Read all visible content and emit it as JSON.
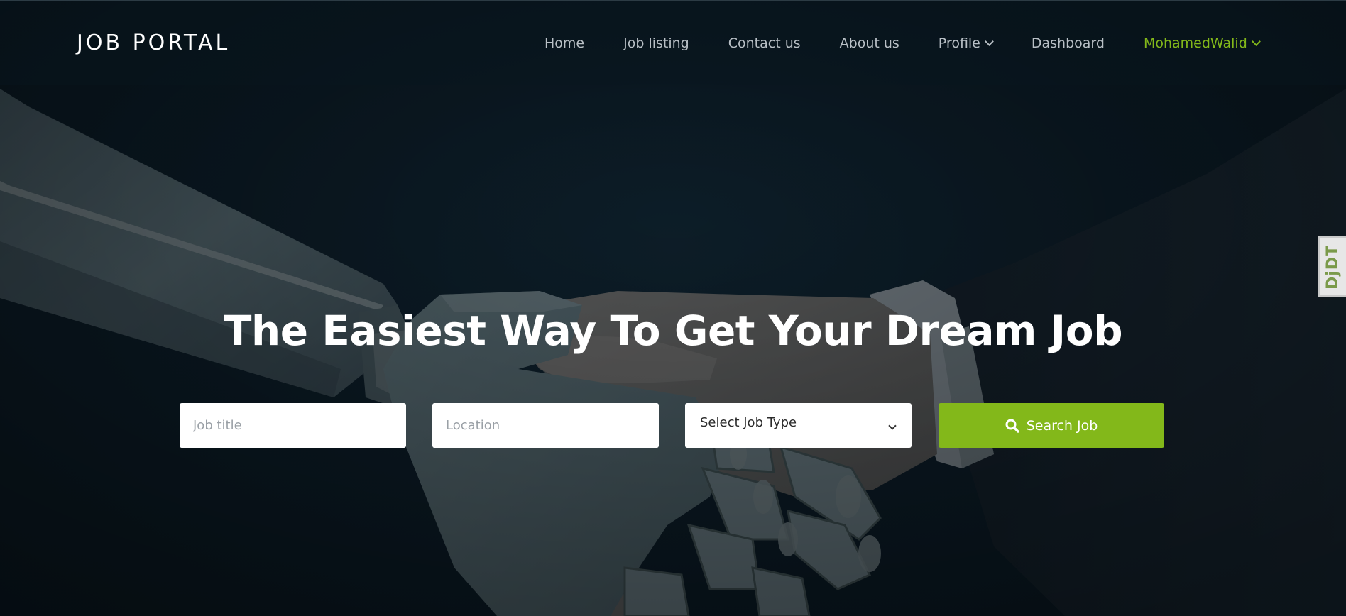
{
  "header": {
    "logo": "JOB PORTAL",
    "nav": [
      {
        "label": "Home"
      },
      {
        "label": "Job listing"
      },
      {
        "label": "Contact us"
      },
      {
        "label": "About us"
      },
      {
        "label": "Profile"
      },
      {
        "label": "Dashboard"
      }
    ],
    "user": "MohamedWalid"
  },
  "hero": {
    "title": "The Easiest Way To Get Your Dream Job",
    "image": "robot-human-handshake"
  },
  "search": {
    "job_title_placeholder": "Job title",
    "location_placeholder": "Location",
    "job_type_selected": "Select Job Type",
    "button_label": "Search Job"
  },
  "debug_toolbar": {
    "label": "DjDT"
  },
  "colors": {
    "accent": "#83b81a",
    "background": "#0a1a24",
    "nav_text": "#b9c0c6"
  }
}
